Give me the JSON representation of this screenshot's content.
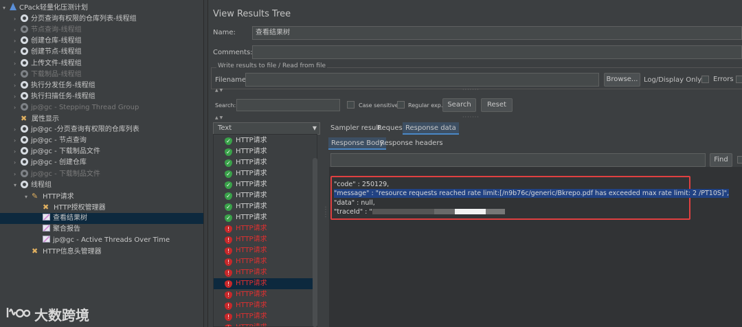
{
  "tree": {
    "items": [
      {
        "label": "CPack轻量化压测计划",
        "kind": "plan",
        "indent": 0,
        "arrow": "▾",
        "disabled": false
      },
      {
        "label": "分页查询有权限的仓库列表-线程组",
        "kind": "gear",
        "indent": 1,
        "arrow": "›",
        "disabled": false
      },
      {
        "label": "节点查询-线程组",
        "kind": "gear",
        "indent": 1,
        "arrow": "›",
        "disabled": true
      },
      {
        "label": "创建仓库-线程组",
        "kind": "gear",
        "indent": 1,
        "arrow": "›",
        "disabled": false
      },
      {
        "label": "创建节点-线程组",
        "kind": "gear",
        "indent": 1,
        "arrow": "›",
        "disabled": false
      },
      {
        "label": "上传文件-线程组",
        "kind": "gear",
        "indent": 1,
        "arrow": "›",
        "disabled": false
      },
      {
        "label": "下载制品-线程组",
        "kind": "gear",
        "indent": 1,
        "arrow": "›",
        "disabled": true
      },
      {
        "label": "执行分发任务-线程组",
        "kind": "gear",
        "indent": 1,
        "arrow": "›",
        "disabled": false
      },
      {
        "label": "执行扫描任务-线程组",
        "kind": "gear",
        "indent": 1,
        "arrow": "›",
        "disabled": false
      },
      {
        "label": "jp@gc - Stepping Thread Group",
        "kind": "gear",
        "indent": 1,
        "arrow": "›",
        "disabled": true
      },
      {
        "label": "属性显示",
        "kind": "tools",
        "indent": 1,
        "arrow": "",
        "disabled": false
      },
      {
        "label": "jp@gc -分页查询有权限的仓库列表",
        "kind": "gear",
        "indent": 1,
        "arrow": "›",
        "disabled": false
      },
      {
        "label": "jp@gc - 节点查询",
        "kind": "gear",
        "indent": 1,
        "arrow": "›",
        "disabled": false
      },
      {
        "label": "jp@gc - 下载制品文件",
        "kind": "gear",
        "indent": 1,
        "arrow": "›",
        "disabled": false
      },
      {
        "label": "jp@gc - 创建仓库",
        "kind": "gear",
        "indent": 1,
        "arrow": "›",
        "disabled": false
      },
      {
        "label": "jp@gc - 下载制品文件",
        "kind": "gear",
        "indent": 1,
        "arrow": "›",
        "disabled": true
      },
      {
        "label": "线程组",
        "kind": "gear",
        "indent": 1,
        "arrow": "▾",
        "disabled": false
      },
      {
        "label": "HTTP请求",
        "kind": "pen",
        "indent": 2,
        "arrow": "▾",
        "disabled": false
      },
      {
        "label": "HTTP授权管理器",
        "kind": "tools",
        "indent": 3,
        "arrow": "",
        "disabled": false
      },
      {
        "label": "查看结果树",
        "kind": "chart",
        "indent": 3,
        "arrow": "",
        "disabled": false,
        "selected": true
      },
      {
        "label": "聚合报告",
        "kind": "chart",
        "indent": 3,
        "arrow": "",
        "disabled": false
      },
      {
        "label": "jp@gc - Active Threads Over Time",
        "kind": "chart",
        "indent": 3,
        "arrow": "",
        "disabled": false
      },
      {
        "label": "HTTP信息头管理器",
        "kind": "tools",
        "indent": 2,
        "arrow": "",
        "disabled": false
      }
    ]
  },
  "panel": {
    "title": "View Results Tree",
    "name_label": "Name:",
    "name_value": "查看结果树",
    "comments_label": "Comments:",
    "write_results_title": "Write results to file / Read from file",
    "filename_label": "Filename",
    "browse_label": "Browse...",
    "log_display_label": "Log/Display Only:",
    "errors_label": "Errors"
  },
  "search": {
    "label": "Search:",
    "case_sensitive": "Case sensitive",
    "regular_exp": "Regular exp.",
    "search_button": "Search",
    "reset_button": "Reset"
  },
  "results": {
    "renderer": "Text",
    "items": [
      {
        "label": "HTTP请求",
        "status": "ok"
      },
      {
        "label": "HTTP请求",
        "status": "ok"
      },
      {
        "label": "HTTP请求",
        "status": "ok"
      },
      {
        "label": "HTTP请求",
        "status": "ok"
      },
      {
        "label": "HTTP请求",
        "status": "ok"
      },
      {
        "label": "HTTP请求",
        "status": "ok"
      },
      {
        "label": "HTTP请求",
        "status": "ok"
      },
      {
        "label": "HTTP请求",
        "status": "ok"
      },
      {
        "label": "HTTP请求",
        "status": "err"
      },
      {
        "label": "HTTP请求",
        "status": "err"
      },
      {
        "label": "HTTP请求",
        "status": "err"
      },
      {
        "label": "HTTP请求",
        "status": "err"
      },
      {
        "label": "HTTP请求",
        "status": "err"
      },
      {
        "label": "HTTP请求",
        "status": "err",
        "selected": true
      },
      {
        "label": "HTTP请求",
        "status": "err"
      },
      {
        "label": "HTTP请求",
        "status": "err"
      },
      {
        "label": "HTTP请求",
        "status": "err"
      },
      {
        "label": "HTTP请求",
        "status": "err"
      }
    ]
  },
  "tabs": {
    "sampler_result": "Sampler result",
    "request": "Request",
    "response_data": "Response data",
    "response_body": "Response Body",
    "response_headers": "Response headers",
    "find_button": "Find"
  },
  "response": {
    "line1": "\"code\" : 250129,",
    "line2": "\"message\" : \"resource requests reached rate limit:[/n9b76c/generic/Bkrepo.pdf has exceeded max rate limit: 2 /PT10S]\",",
    "line3": "\"data\" : null,",
    "line4": "\"traceId\" : \""
  },
  "watermark": {
    "logo": "大数跨境"
  },
  "colors": {
    "ok": "#3aa24a",
    "error": "#e03030",
    "highlight_border": "#e04040",
    "selection": "#214283"
  }
}
